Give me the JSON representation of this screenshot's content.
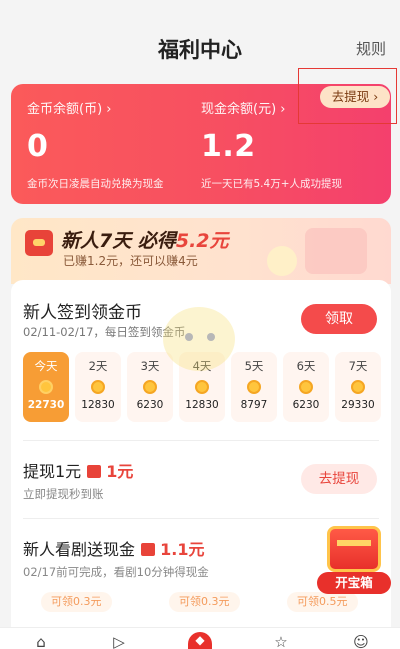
{
  "header": {
    "title": "福利中心",
    "rules": "规则"
  },
  "balance": {
    "coin_label": "金币余额(币) ›",
    "coin_value": "0",
    "coin_note": "金币次日凌晨自动兑换为现金",
    "cash_label": "现金余额(元) ›",
    "cash_value": "1.2",
    "cash_note": "近一天已有5.4万+人成功提现",
    "withdraw_button": "去提现 ›"
  },
  "promo": {
    "headline_prefix": "新人7天 必得",
    "headline_amount": "5.2元",
    "sub": "已赚1.2元，还可以赚4元"
  },
  "signin": {
    "title": "新人签到领金币",
    "desc": "02/11-02/17，每日签到领金币",
    "button": "领取",
    "days": [
      {
        "label": "今天",
        "amount": "22730"
      },
      {
        "label": "2天",
        "amount": "12830"
      },
      {
        "label": "3天",
        "amount": "6230"
      },
      {
        "label": "4天",
        "amount": "12830"
      },
      {
        "label": "5天",
        "amount": "8797"
      },
      {
        "label": "6天",
        "amount": "6230"
      },
      {
        "label": "7天",
        "amount": "29330"
      }
    ]
  },
  "withdraw_task": {
    "title": "提现1元",
    "reward": "1元",
    "desc": "立即提现秒到账",
    "button": "去提现"
  },
  "video_task": {
    "title": "新人看剧送现金",
    "reward": "1.1元",
    "desc": "02/17前可完成，看剧10分钟得现金",
    "tags": [
      "可领0.3元",
      "可领0.3元",
      "可领0.5元"
    ]
  },
  "treasure": {
    "label": "开宝箱"
  },
  "colors": {
    "accent": "#f44b4b",
    "orange": "#f79d35"
  }
}
